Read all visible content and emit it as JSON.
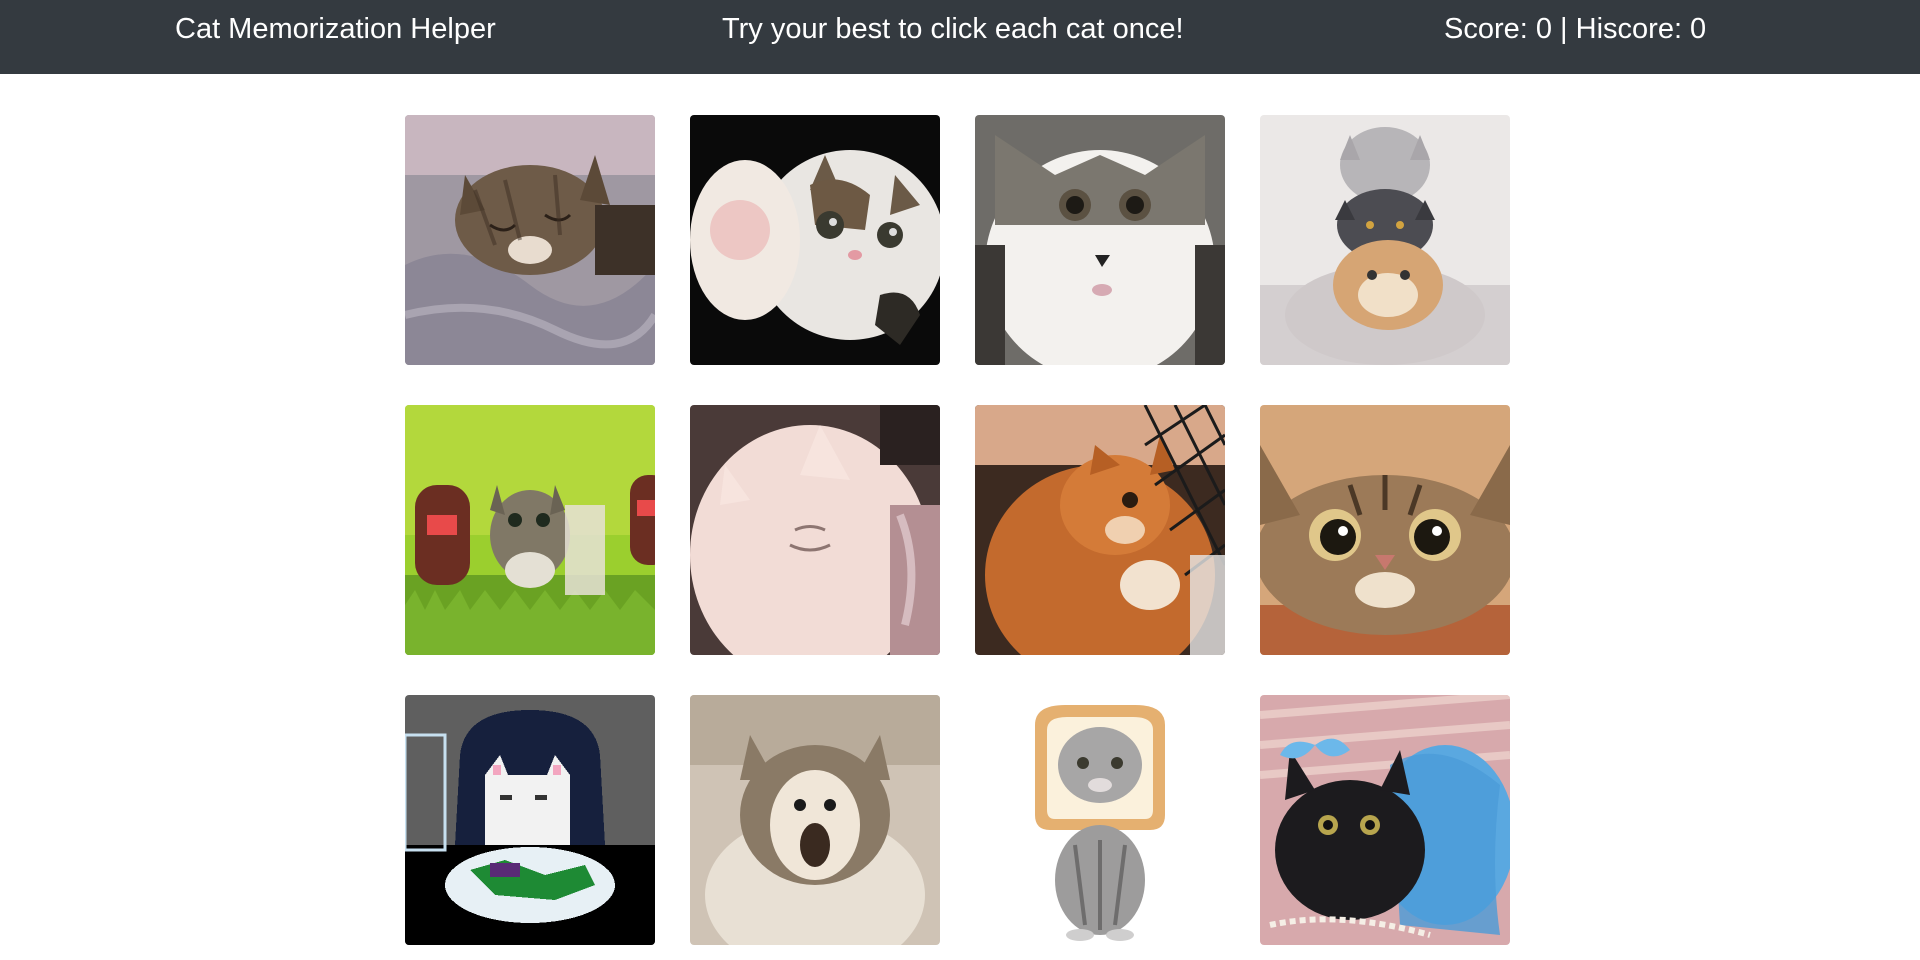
{
  "navbar": {
    "brand": "Cat Memorization Helper",
    "instructions": "Try your best to click each cat once!",
    "score_text": "Score: 0 | Hiscore: 0"
  },
  "cards": [
    {
      "name": "sleeping-tabby-cat"
    },
    {
      "name": "calico-kitten-paw"
    },
    {
      "name": "white-gray-cat-face"
    },
    {
      "name": "stacked-cats"
    },
    {
      "name": "kitten-running-with-domo"
    },
    {
      "name": "fluffy-white-cat"
    },
    {
      "name": "orange-cat-with-net"
    },
    {
      "name": "wide-eyed-tabby"
    },
    {
      "name": "pixel-art-table-cat"
    },
    {
      "name": "popcat-meme"
    },
    {
      "name": "bread-head-cat"
    },
    {
      "name": "black-cat-blue-tutu"
    }
  ],
  "colors": {
    "navbar_bg": "#343a40",
    "navbar_text": "#ffffff",
    "page_bg": "#ffffff"
  }
}
